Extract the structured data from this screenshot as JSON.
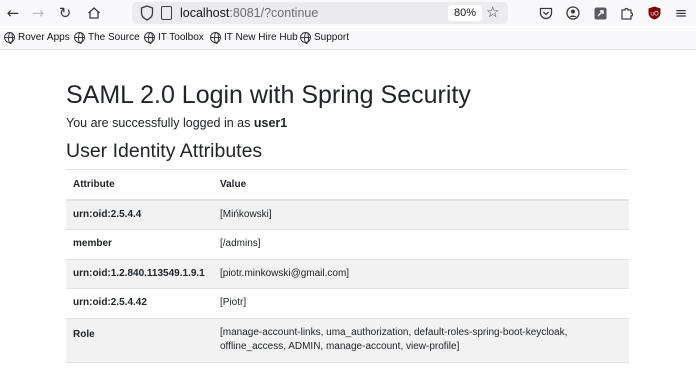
{
  "browser": {
    "url_host": "localhost",
    "url_rest": ":8081/?continue",
    "zoom": "80%"
  },
  "bookmarks": [
    {
      "label": "Rover Apps"
    },
    {
      "label": "The Source"
    },
    {
      "label": "IT Toolbox"
    },
    {
      "label": "IT New Hire Hub"
    },
    {
      "label": "Support"
    }
  ],
  "page": {
    "title": "SAML 2.0 Login with Spring Security",
    "logged_prefix": "You are successfully logged in as ",
    "username": "user1",
    "section_title": "User Identity Attributes"
  },
  "table": {
    "headers": [
      "Attribute",
      "Value"
    ],
    "rows": [
      {
        "attribute": "urn:oid:2.5.4.4",
        "value": "[Mińkowski]"
      },
      {
        "attribute": "member",
        "value": "[/admins]"
      },
      {
        "attribute": "urn:oid:1.2.840.113549.1.9.1",
        "value": "[piotr.minkowski@gmail.com]"
      },
      {
        "attribute": "urn:oid:2.5.4.42",
        "value": "[Piotr]"
      },
      {
        "attribute": "Role",
        "value_line1": "[manage-account-links, uma_authorization, default-roles-spring-boot-keycloak,",
        "value_line2": "offline_access, ADMIN, manage-account, view-profile]"
      }
    ]
  }
}
